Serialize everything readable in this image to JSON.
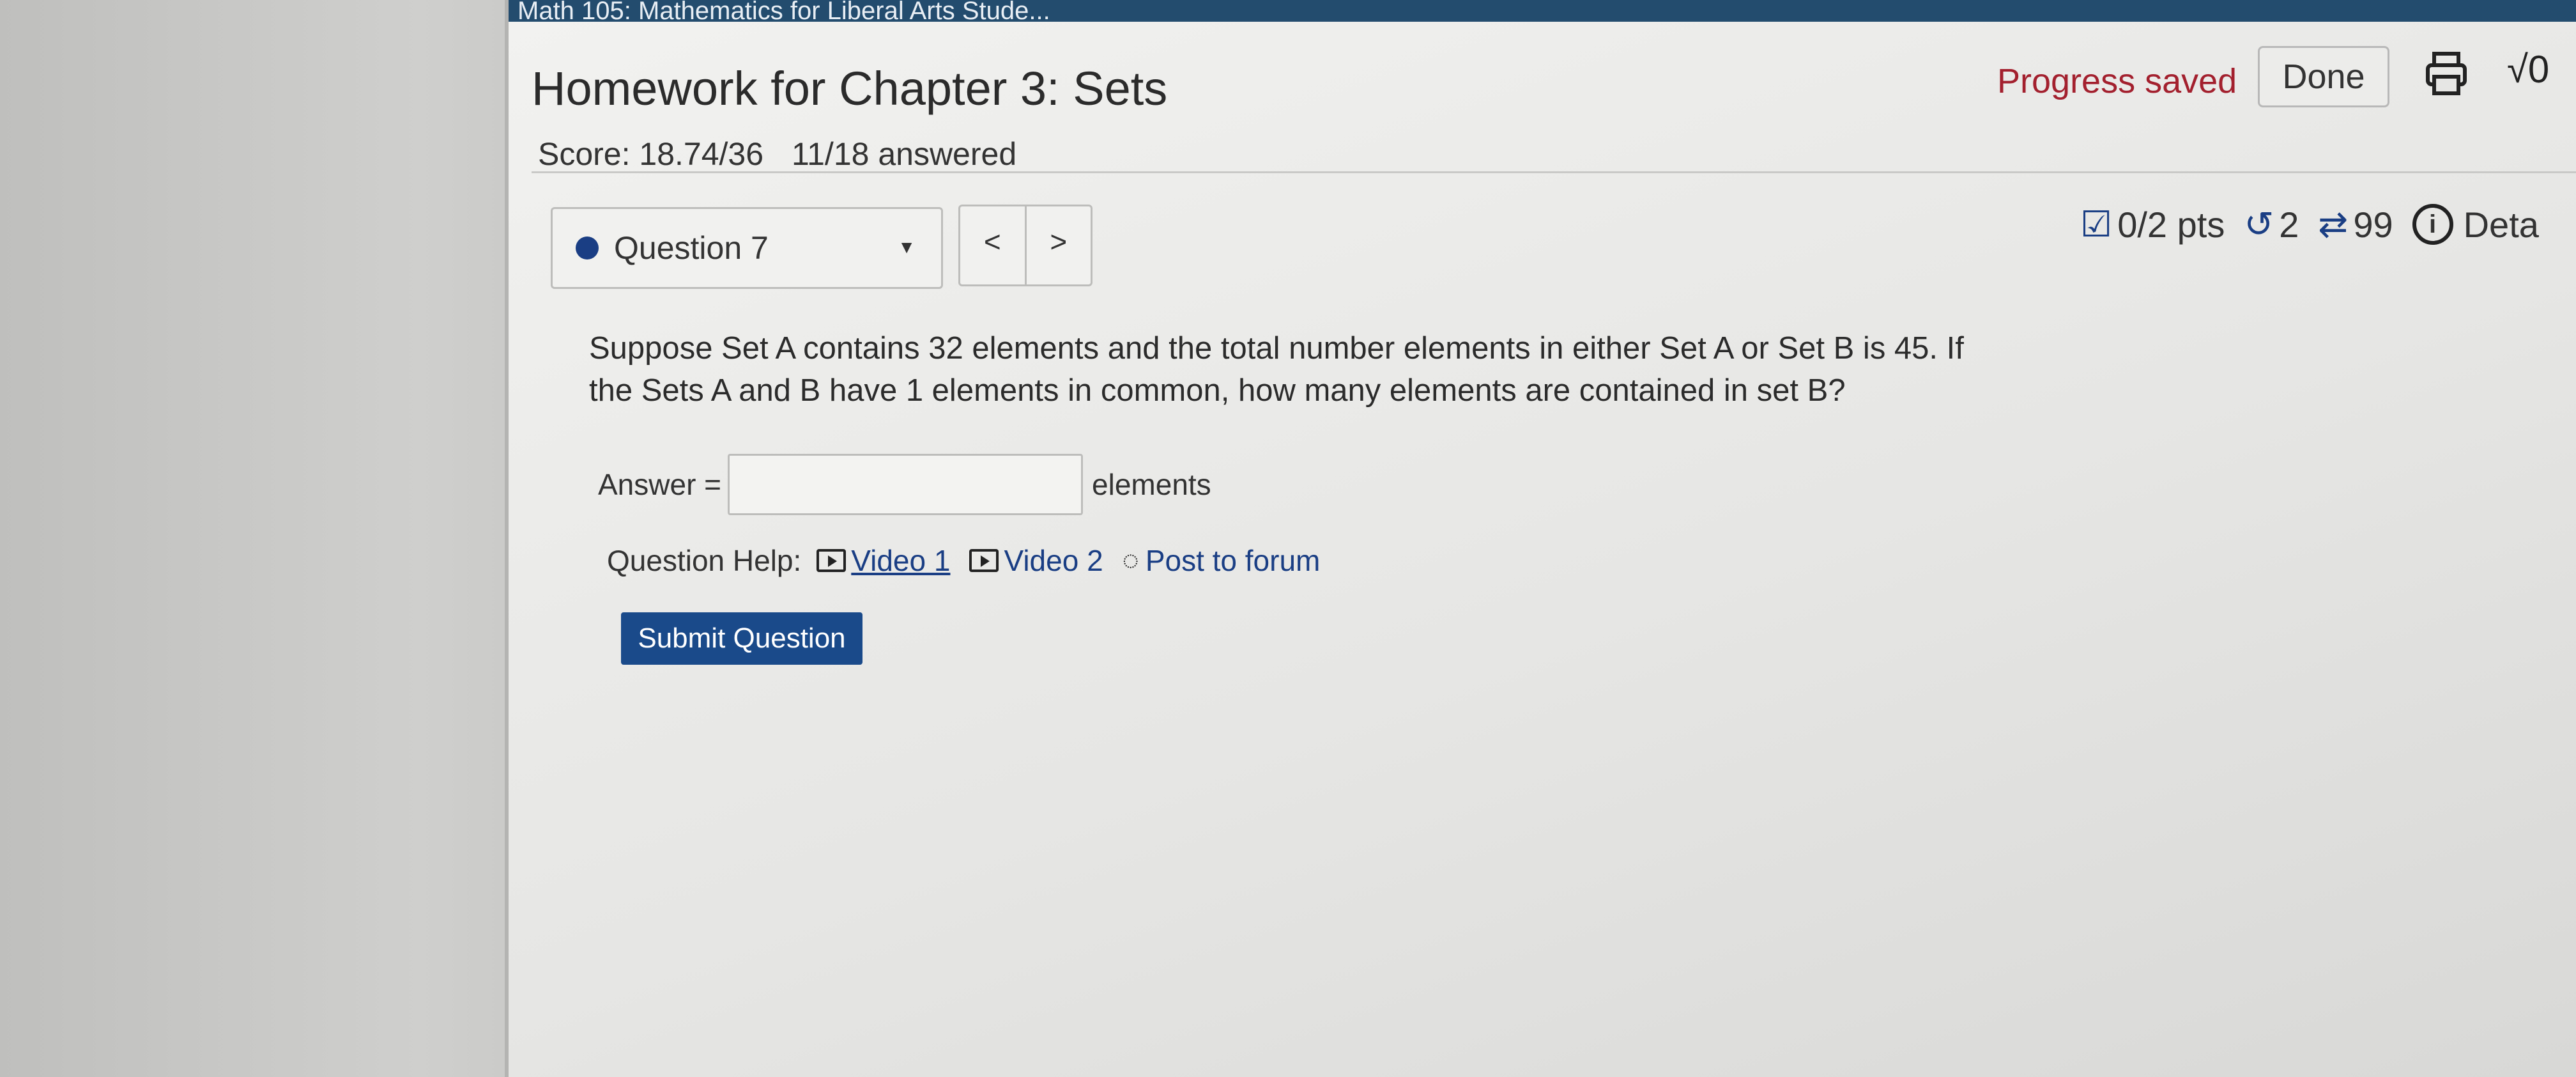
{
  "topbar": {
    "course": "Math 105: Mathematics for Liberal Arts Stude..."
  },
  "header": {
    "title": "Homework for Chapter 3: Sets",
    "score": "Score: 18.74/36",
    "answered": "11/18 answered",
    "progress": "Progress saved",
    "done_label": "Done",
    "sqrt_label": "√0"
  },
  "question_nav": {
    "selected": "Question 7",
    "prev": "<",
    "next": ">"
  },
  "stats": {
    "points": "0/2 pts",
    "retries": "2",
    "attempts": "99",
    "details": "Deta"
  },
  "question": {
    "text": "Suppose Set A contains 32 elements and the total number elements in either Set A or Set B is 45. If the Sets A and B have 1 elements in common, how many elements are contained in set B?",
    "answer_label": "Answer =",
    "answer_value": "",
    "units": "elements"
  },
  "help": {
    "label": "Question Help:",
    "video1": "Video 1",
    "video2": "Video 2",
    "forum": "Post to forum"
  },
  "submit_label": "Submit Question",
  "colors": {
    "topbar": "#234c6e",
    "progress": "#a3202e",
    "accent": "#1a3e84",
    "submit": "#1a4a8a"
  },
  "icons": [
    "print-icon",
    "sqrt-icon",
    "checkbox-icon",
    "retry-icon",
    "attempts-icon",
    "info-icon",
    "play-icon",
    "comment-icon",
    "caret-down-icon"
  ]
}
